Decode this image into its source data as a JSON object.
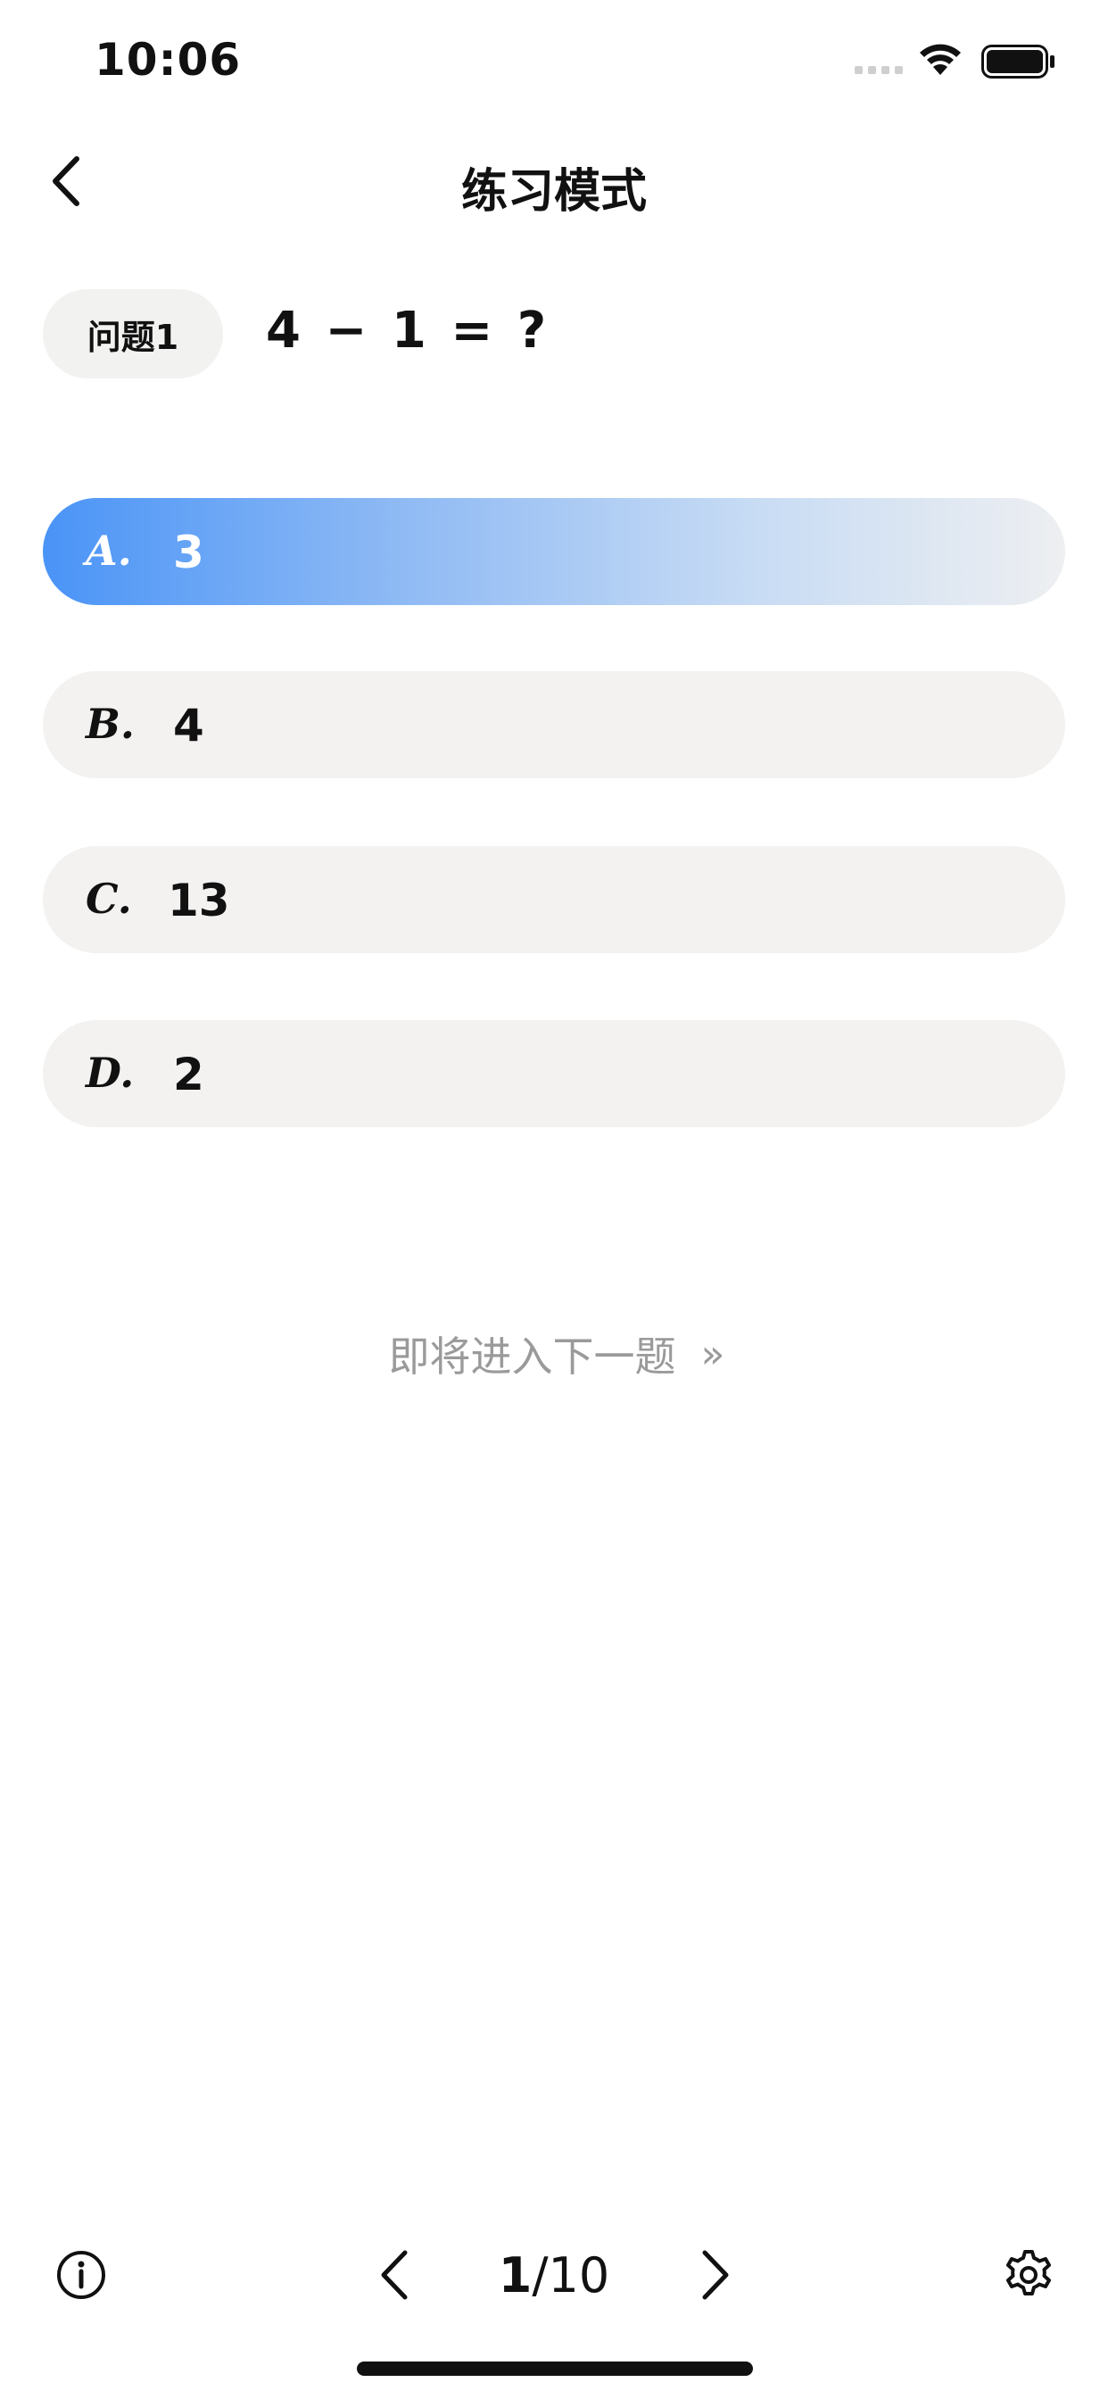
{
  "status_bar": {
    "time": "10:06"
  },
  "nav": {
    "title": "练习模式",
    "back_icon": "chevron-left-icon"
  },
  "question": {
    "tag": "问题1",
    "text": "4 − 1 = ?"
  },
  "options": [
    {
      "letter": "A.",
      "value": "3",
      "selected": true
    },
    {
      "letter": "B.",
      "value": "4",
      "selected": false
    },
    {
      "letter": "C.",
      "value": "13",
      "selected": false
    },
    {
      "letter": "D.",
      "value": "2",
      "selected": false
    }
  ],
  "next_hint": {
    "text": "即将进入下一题",
    "icon": "double-chevron-right-icon",
    "glyph": "»"
  },
  "toolbar": {
    "info_icon": "info-icon",
    "prev_icon": "chevron-left-icon",
    "current_page": "1",
    "total_pages": "/10",
    "next_icon": "chevron-right-icon",
    "settings_icon": "gear-icon"
  },
  "colors": {
    "accent": "#4a94f7",
    "option_bg": "#f3f2f1",
    "hint_text": "#9a9a9a"
  }
}
